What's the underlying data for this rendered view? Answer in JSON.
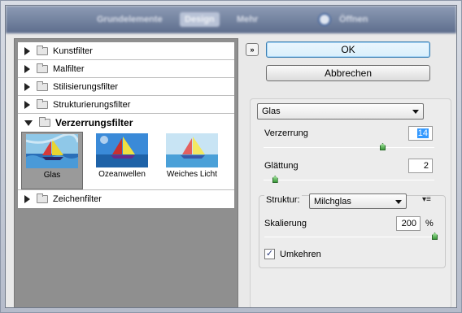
{
  "top_tabs": [
    {
      "label": "Grundelemente",
      "active": false
    },
    {
      "label": "Design",
      "active": true
    },
    {
      "label": "Mehr",
      "active": false
    },
    {
      "label": "Öffnen",
      "active": false
    }
  ],
  "gallery": {
    "categories_before": [
      "Kunstfilter",
      "Malfilter",
      "Stilisierungsfilter",
      "Strukturierungsfilter"
    ],
    "open_category": "Verzerrungsfilter",
    "thumbnails": [
      {
        "label": "Glas",
        "selected": true
      },
      {
        "label": "Ozeanwellen",
        "selected": false
      },
      {
        "label": "Weiches Licht",
        "selected": false
      }
    ],
    "categories_after": [
      "Zeichenfilter"
    ]
  },
  "buttons": {
    "ok": "OK",
    "cancel": "Abbrechen",
    "expand_glyph": "»"
  },
  "filter": {
    "selected": "Glas",
    "verzerrung_label": "Verzerrung",
    "verzerrung_value": "14",
    "verzerrung_level": 0.7,
    "glaettung_label": "Glättung",
    "glaettung_value": "2",
    "glaettung_level": 0.07,
    "struktur_label": "Struktur:",
    "struktur_value": "Milchglas",
    "skalierung_label": "Skalierung",
    "skalierung_value": "200",
    "skalierung_unit": "%",
    "skalierung_level": 1.0,
    "umkehren_label": "Umkehren",
    "umkehren_checked": true
  },
  "colors": {
    "accent": "#3c7fb1",
    "selection": "#3399ff",
    "slider_knob": "#3a9a3a"
  }
}
